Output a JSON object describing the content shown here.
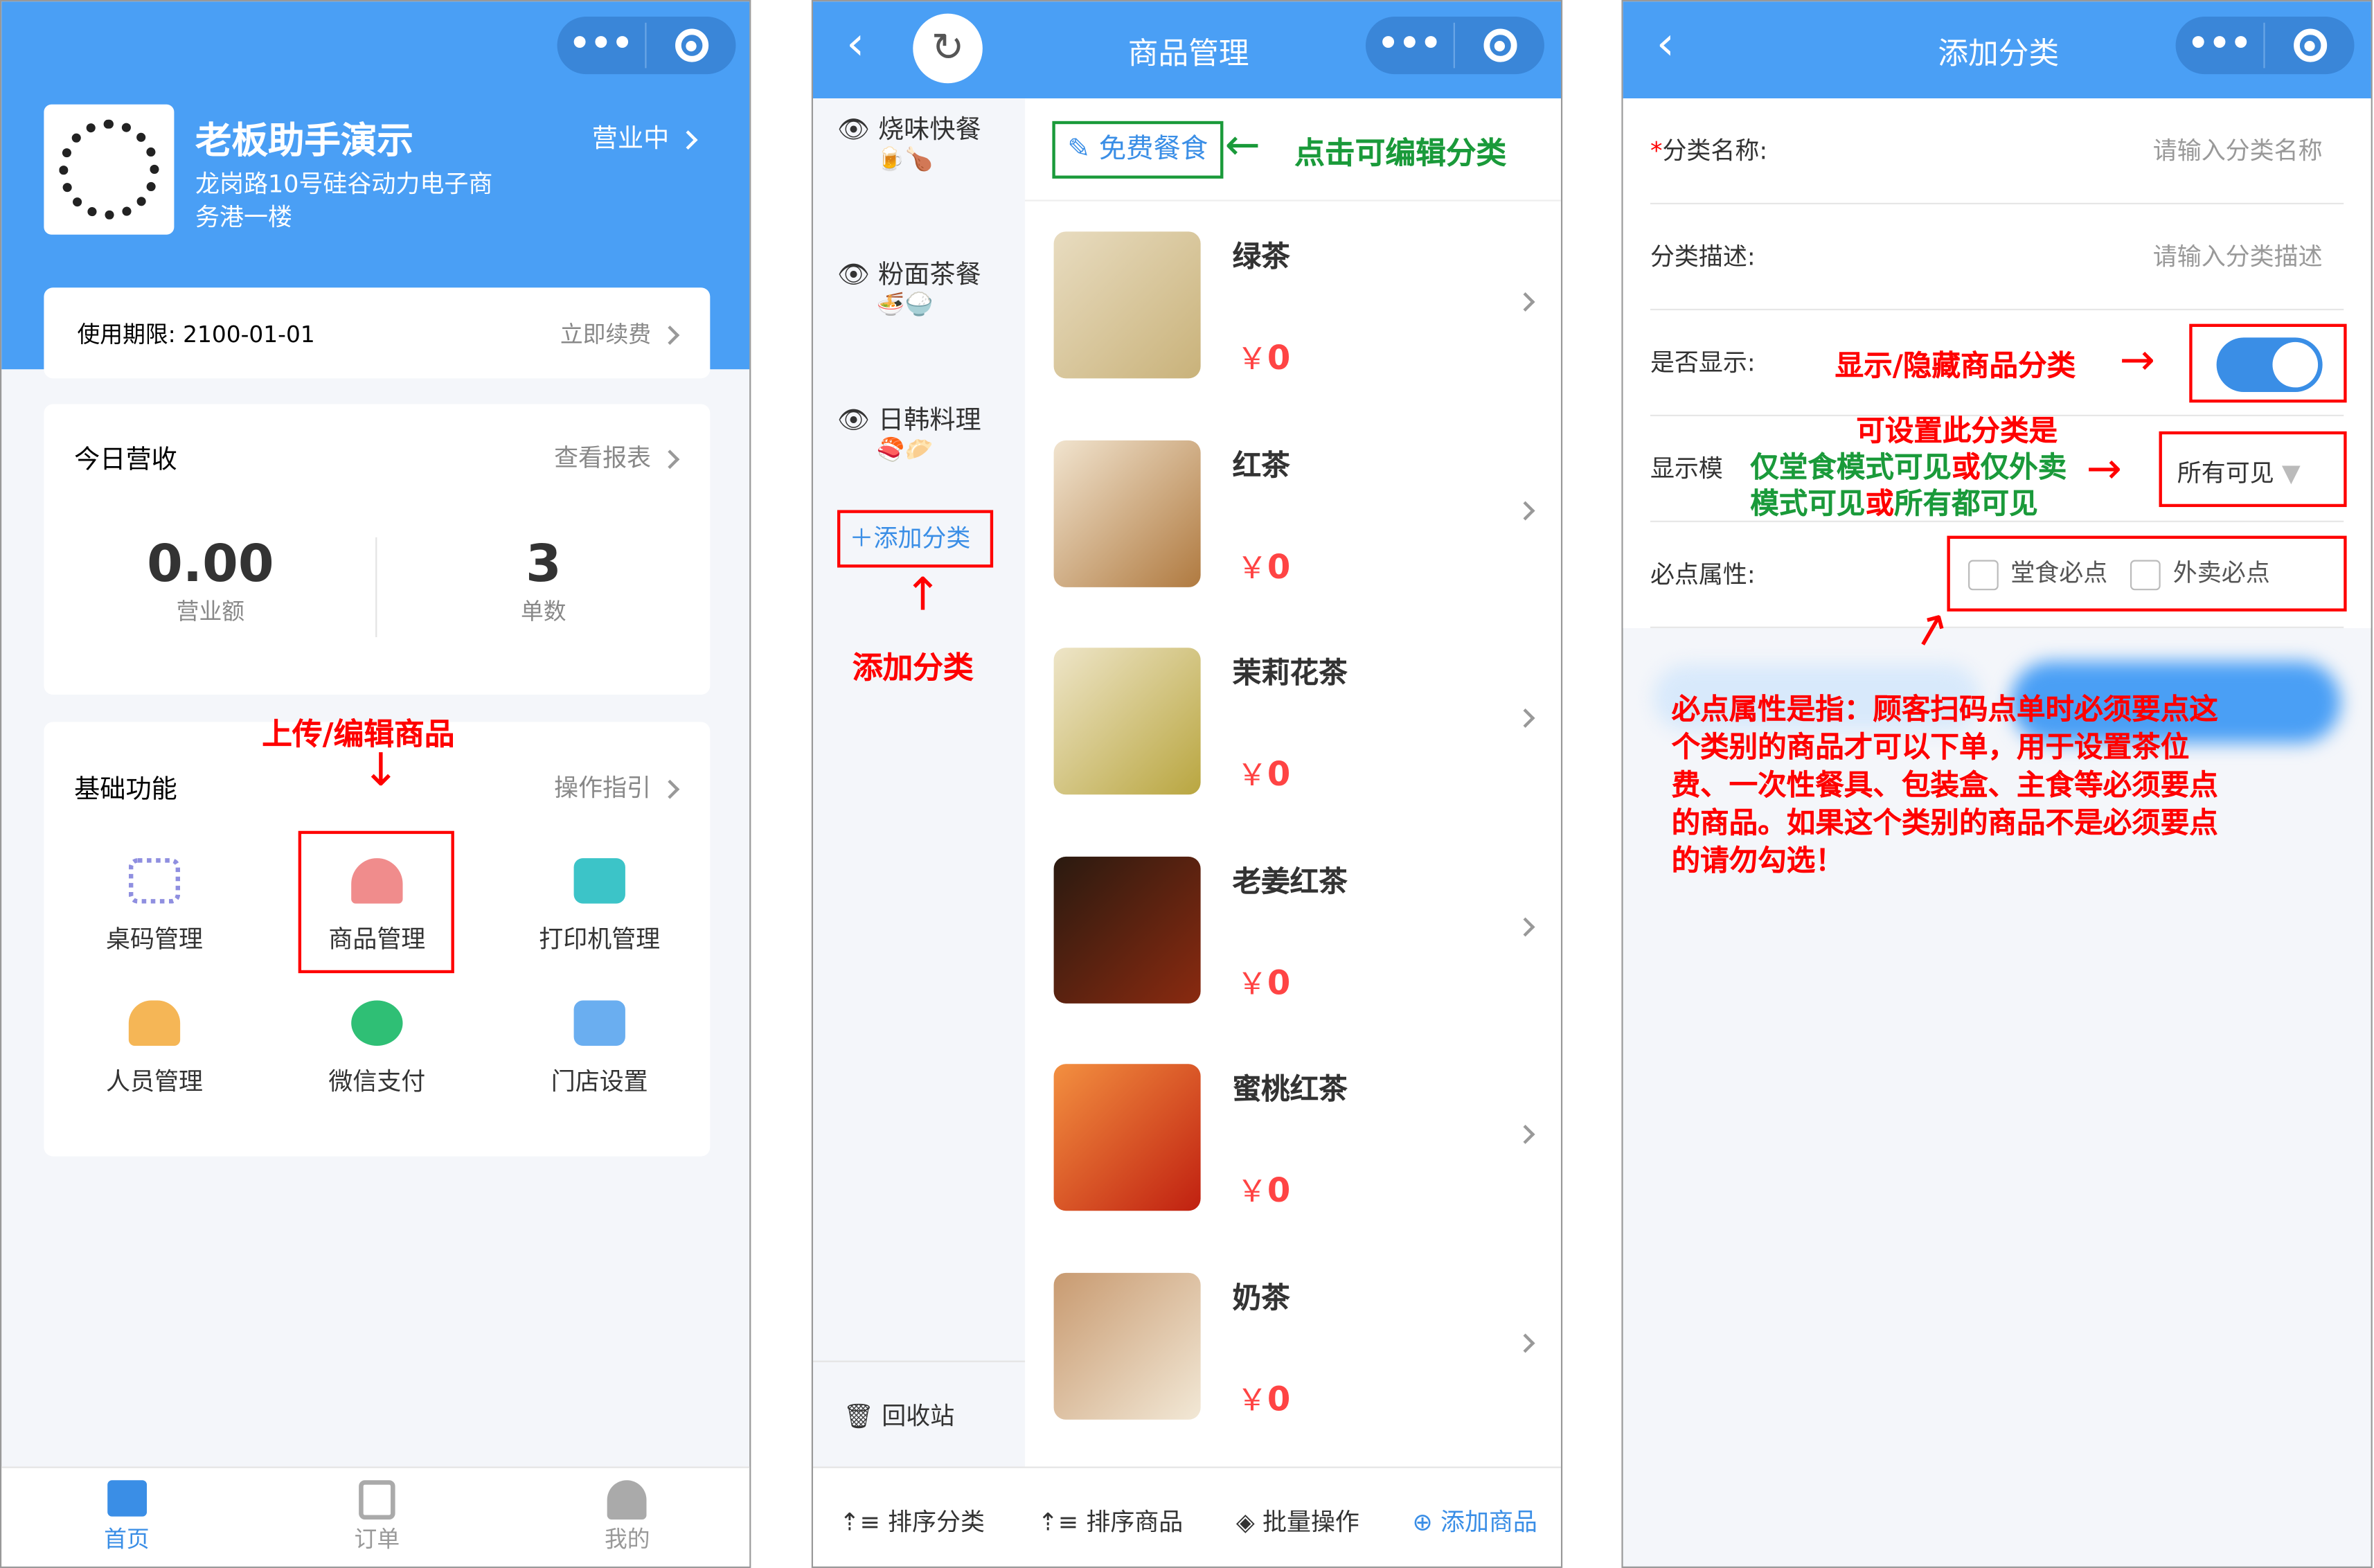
{
  "colors": {
    "primary": "#4a9ff5",
    "annotation_red": "#ff0000",
    "annotation_green": "#1a9a3a"
  },
  "home": {
    "store_name": "老板助手演示",
    "status": "营业中",
    "address_line1": "龙岗路10号硅谷动力电子商",
    "address_line2": "务港一楼",
    "expiry": "使用期限: 2100-01-01",
    "renew": "立即续费",
    "today_title": "今日营收",
    "view_report": "查看报表",
    "revenue_value": "0.00",
    "revenue_label": "营业额",
    "orders_value": "3",
    "orders_label": "单数",
    "basic_title": "基础功能",
    "guide": "操作指引",
    "features": [
      {
        "label": "桌码管理",
        "icon": "qr-grid-icon"
      },
      {
        "label": "商品管理",
        "icon": "cloche-icon"
      },
      {
        "label": "打印机管理",
        "icon": "printer-icon"
      },
      {
        "label": "人员管理",
        "icon": "people-icon"
      },
      {
        "label": "微信支付",
        "icon": "wechat-pay-icon"
      },
      {
        "label": "门店设置",
        "icon": "store-icon"
      }
    ],
    "annotation": "上传/编辑商品",
    "tabbar": [
      {
        "label": "首页",
        "icon": "store-icon",
        "active": true
      },
      {
        "label": "订单",
        "icon": "order-list-icon"
      },
      {
        "label": "我的",
        "icon": "user-icon"
      }
    ]
  },
  "goods": {
    "title": "商品管理",
    "categories": [
      {
        "name": "烧味快餐",
        "emoji": "🍺🍗"
      },
      {
        "name": "粉面茶餐",
        "emoji": "🍜🍚"
      },
      {
        "name": "日韩料理",
        "emoji": "🍣🥟"
      }
    ],
    "add_category": "添加分类",
    "recycle": "回收站",
    "current_category": "免费餐食",
    "edit_hint": "点击可编辑分类",
    "add_hint": "添加分类",
    "products": [
      {
        "name": "绿茶",
        "price": "0"
      },
      {
        "name": "红茶",
        "price": "0"
      },
      {
        "name": "茉莉花茶",
        "price": "0"
      },
      {
        "name": "老姜红茶",
        "price": "0"
      },
      {
        "name": "蜜桃红茶",
        "price": "0"
      },
      {
        "name": "奶茶",
        "price": "0"
      }
    ],
    "currency": "￥",
    "toolbar": [
      "排序分类",
      "排序商品",
      "批量操作",
      "添加商品"
    ]
  },
  "add_cat": {
    "title": "添加分类",
    "name_label": "分类名称:",
    "name_placeholder": "请输入分类名称",
    "desc_label": "分类描述:",
    "desc_placeholder": "请输入分类描述",
    "show_label": "是否显示:",
    "show_on": true,
    "show_note": "显示/隐藏商品分类",
    "mode_label": "显示模",
    "mode_value": "所有可见",
    "mode_note": [
      [
        "可设置此分类是",
        "red"
      ],
      [
        "仅堂食",
        "green"
      ],
      [
        "模式可见",
        "green"
      ],
      [
        "或",
        "red"
      ],
      [
        "仅外卖模式",
        "green"
      ],
      [
        "可见",
        "green"
      ],
      [
        "或",
        "red"
      ],
      [
        "所有都可见",
        "green"
      ]
    ],
    "required_label": "必点属性:",
    "dine_in": "堂食必点",
    "takeout": "外卖必点",
    "required_note": "必点属性是指：顾客扫码点单时必须要点这个类别的商品才可以下单，用于设置茶位费、一次性餐具、包装盒、主食等必须要点的商品。如果这个类别的商品不是必须要点的请勿勾选！"
  }
}
